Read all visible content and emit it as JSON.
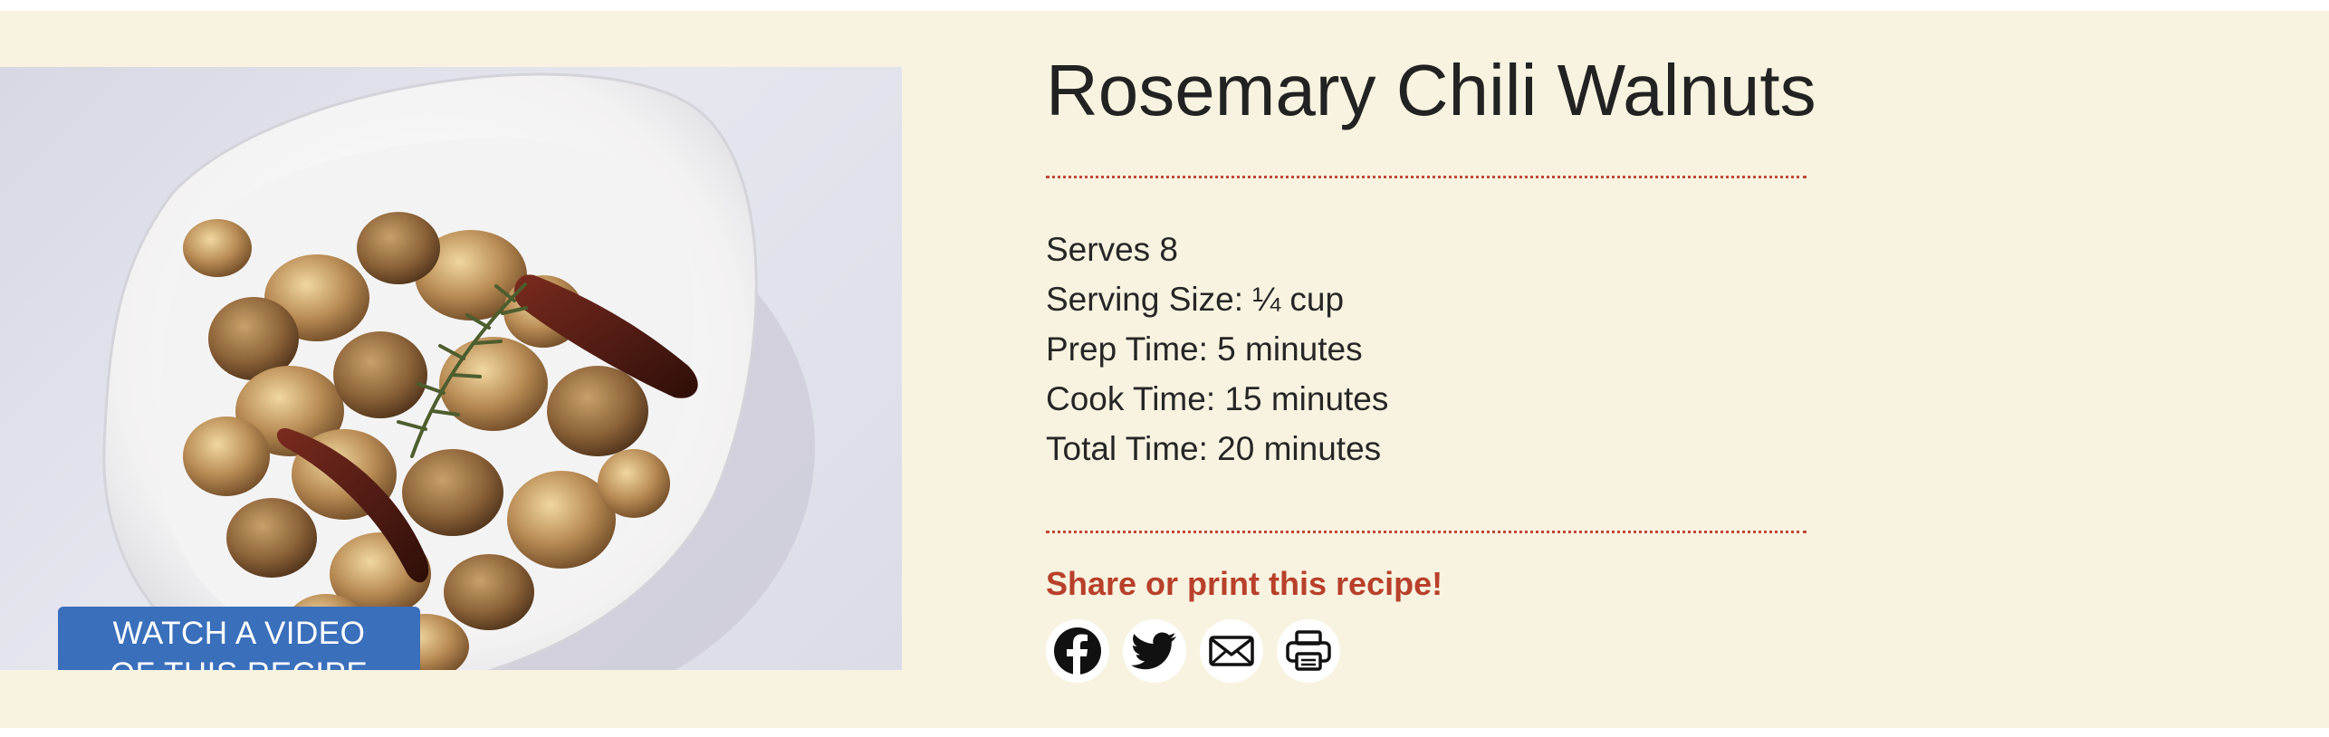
{
  "recipe": {
    "title": "Rosemary Chili Walnuts",
    "details": [
      "Serves 8",
      "Serving Size: ¼ cup",
      "Prep Time: 5 minutes",
      "Cook Time: 15 minutes",
      "Total Time: 20 minutes"
    ]
  },
  "video_button": {
    "line1": "WATCH A VIDEO",
    "line2": "OF THIS RECIPE"
  },
  "share": {
    "heading": "Share or print this recipe!",
    "icons": [
      "facebook-icon",
      "twitter-icon",
      "email-icon",
      "print-icon"
    ]
  },
  "colors": {
    "background": "#f8f3e0",
    "accent": "#b8402b",
    "button": "#3a6fbb"
  }
}
